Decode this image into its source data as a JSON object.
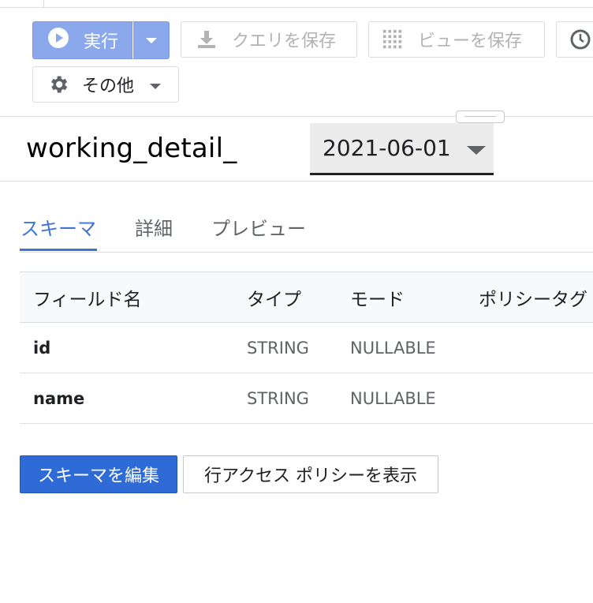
{
  "toolbar": {
    "run_label": "実行",
    "save_query_label": "クエリを保存",
    "save_view_label": "ビューを保存",
    "more_label": "その他"
  },
  "table": {
    "title": "working_detail_",
    "partition_date": "2021-06-01"
  },
  "tabs": [
    {
      "label": "スキーマ",
      "active": true
    },
    {
      "label": "詳細",
      "active": false
    },
    {
      "label": "プレビュー",
      "active": false
    }
  ],
  "schema": {
    "columns": [
      "フィールド名",
      "タイプ",
      "モード",
      "ポリシータグ"
    ],
    "rows": [
      {
        "name": "id",
        "type": "STRING",
        "mode": "NULLABLE",
        "policy": ""
      },
      {
        "name": "name",
        "type": "STRING",
        "mode": "NULLABLE",
        "policy": ""
      }
    ]
  },
  "actions": {
    "edit_schema": "スキーマを編集",
    "row_access": "行アクセス ポリシーを表示"
  },
  "colors": {
    "accent": "#3f73d6",
    "run_button": "#8aa8eb",
    "primary_button": "#2f6bd6"
  },
  "icons": [
    "play-icon",
    "dropdown-arrow-icon",
    "download-icon",
    "grid-icon",
    "clock-icon",
    "gear-icon",
    "chevron-down-icon"
  ]
}
